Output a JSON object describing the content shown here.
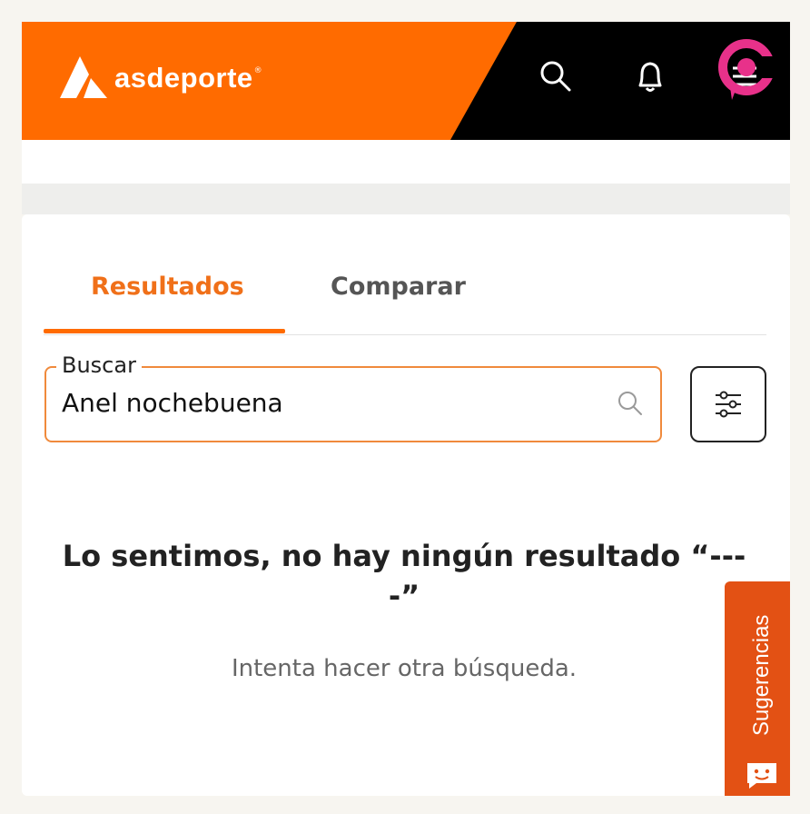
{
  "header": {
    "brand": "asdeporte",
    "brand_mark": "®",
    "colors": {
      "orange": "#ff6b00",
      "black": "#000000"
    },
    "icons": [
      "search-icon",
      "bell-icon",
      "menu-icon"
    ]
  },
  "tabs": [
    {
      "label": "Resultados",
      "active": true
    },
    {
      "label": "Comparar",
      "active": false
    }
  ],
  "search": {
    "label": "Buscar",
    "value": "Anel nochebuena"
  },
  "empty_state": {
    "title": "Lo sentimos, no hay ningún resultado “----”",
    "subtitle": "Intenta hacer otra búsqueda."
  },
  "suggestions": {
    "label": "Sugerencias"
  }
}
